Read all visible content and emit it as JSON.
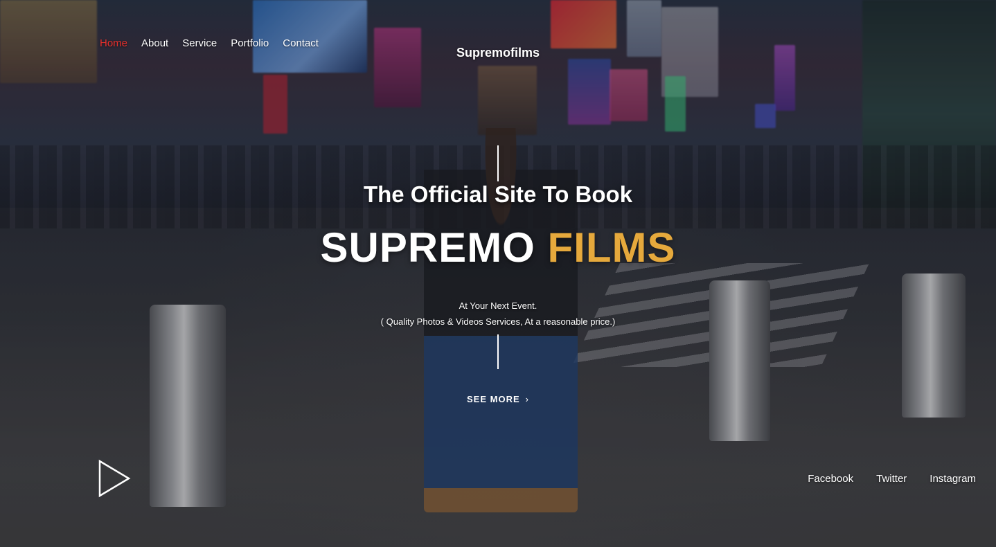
{
  "nav": {
    "items": [
      {
        "label": "Home",
        "active": true
      },
      {
        "label": "About",
        "active": false
      },
      {
        "label": "Service",
        "active": false
      },
      {
        "label": "Portfolio",
        "active": false
      },
      {
        "label": "Contact",
        "active": false
      }
    ],
    "active_color": "#e8302c"
  },
  "brand": "Supremofilms",
  "hero": {
    "subtitle": "The Official Site To Book",
    "title_main": "SUPREMO",
    "title_accent": "FILMS",
    "accent_color": "#e6a93c",
    "tagline_line1": "At Your Next Event.",
    "tagline_line2": "( Quality Photos & Videos Services, At a reasonable price.)",
    "cta_label": "SEE MORE",
    "cta_icon": "chevron-right-icon"
  },
  "video": {
    "icon": "play-icon"
  },
  "social": [
    {
      "label": "Facebook"
    },
    {
      "label": "Twitter"
    },
    {
      "label": "Instagram"
    }
  ]
}
